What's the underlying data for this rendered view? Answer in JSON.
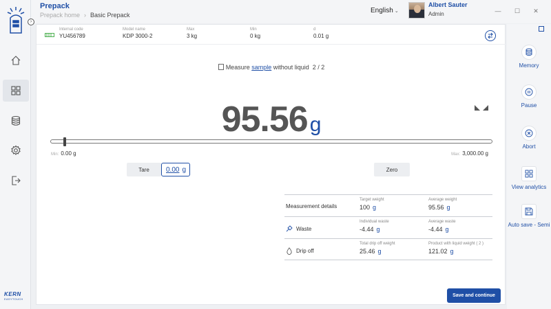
{
  "header": {
    "app_title": "Prepack",
    "breadcrumb": [
      "Prepack home",
      "Basic Prepack"
    ],
    "language": "English",
    "user": {
      "name": "Albert Sauter",
      "role": "Admin"
    }
  },
  "window_controls": {
    "minimize": "—",
    "maximize": "☐",
    "close": "✕"
  },
  "brand": {
    "logo_text": "KERN",
    "logo_subtext": "EASYTOUCH"
  },
  "left_nav": [
    "home-icon",
    "dashboard-icon",
    "database-icon",
    "settings-icon",
    "logout-icon"
  ],
  "info_bar": [
    {
      "label": "Internal code",
      "value": "YU456789"
    },
    {
      "label": "Model name",
      "value": "KDP 3000-2"
    },
    {
      "label": "Max",
      "value": "3 kg"
    },
    {
      "label": "Min",
      "value": "0 kg"
    },
    {
      "label": "d",
      "value": "0.01 g"
    }
  ],
  "step": {
    "prefix": "Measure",
    "highlight": "sample",
    "suffix": "without liquid",
    "counter": "2 / 2"
  },
  "weight": {
    "value": "95.56",
    "unit": "g"
  },
  "range": {
    "min_label": "Min:",
    "min_value": "0.00 g",
    "max_label": "Max:",
    "max_value": "3,000.00 g",
    "level_fraction": 0.032
  },
  "tare": {
    "label": "Tare",
    "value": "0.00",
    "unit": "g"
  },
  "zero": {
    "label": "Zero"
  },
  "details": {
    "header_label": "Measurement details",
    "rows": [
      {
        "label": "Measurement details",
        "icon": "",
        "c1": {
          "label": "Target weight",
          "value": "100",
          "unit": "g"
        },
        "c2": {
          "label": "Average weight",
          "value": "95.56",
          "unit": "g"
        }
      },
      {
        "label": "Waste",
        "icon": "waste-icon",
        "c1": {
          "label": "Individual waste",
          "value": "-4.44",
          "unit": "g"
        },
        "c2": {
          "label": "Average waste",
          "value": "-4.44",
          "unit": "g"
        }
      },
      {
        "label": "Drip off",
        "icon": "drop-icon",
        "c1": {
          "label": "Total drip off weight",
          "value": "25.46",
          "unit": "g"
        },
        "c2": {
          "label": "Product with liquid weight ( 2 )",
          "value": "121.02",
          "unit": "g"
        }
      }
    ]
  },
  "save_button": "Save and continue",
  "right_actions": [
    {
      "label": "Memory",
      "icon": "memory-icon"
    },
    {
      "label": "Pause",
      "icon": "pause-icon"
    },
    {
      "label": "Abort",
      "icon": "abort-icon"
    },
    {
      "label": "View analytics",
      "icon": "analytics-icon"
    },
    {
      "label": "Auto save - Semi",
      "icon": "autosave-icon"
    }
  ],
  "colors": {
    "accent": "#1f4fa6",
    "weight_text": "#555555",
    "background": "#eef0f3"
  }
}
